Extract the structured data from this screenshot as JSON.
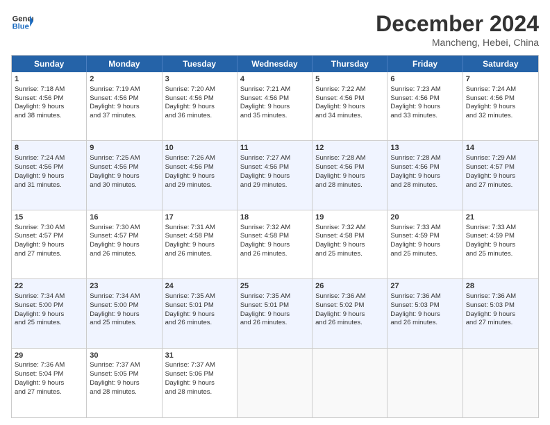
{
  "header": {
    "logo_line1": "General",
    "logo_line2": "Blue",
    "month": "December 2024",
    "location": "Mancheng, Hebei, China"
  },
  "days_of_week": [
    "Sunday",
    "Monday",
    "Tuesday",
    "Wednesday",
    "Thursday",
    "Friday",
    "Saturday"
  ],
  "rows": [
    {
      "alt": false,
      "cells": [
        {
          "day": "1",
          "lines": [
            "Sunrise: 7:18 AM",
            "Sunset: 4:56 PM",
            "Daylight: 9 hours",
            "and 38 minutes."
          ]
        },
        {
          "day": "2",
          "lines": [
            "Sunrise: 7:19 AM",
            "Sunset: 4:56 PM",
            "Daylight: 9 hours",
            "and 37 minutes."
          ]
        },
        {
          "day": "3",
          "lines": [
            "Sunrise: 7:20 AM",
            "Sunset: 4:56 PM",
            "Daylight: 9 hours",
            "and 36 minutes."
          ]
        },
        {
          "day": "4",
          "lines": [
            "Sunrise: 7:21 AM",
            "Sunset: 4:56 PM",
            "Daylight: 9 hours",
            "and 35 minutes."
          ]
        },
        {
          "day": "5",
          "lines": [
            "Sunrise: 7:22 AM",
            "Sunset: 4:56 PM",
            "Daylight: 9 hours",
            "and 34 minutes."
          ]
        },
        {
          "day": "6",
          "lines": [
            "Sunrise: 7:23 AM",
            "Sunset: 4:56 PM",
            "Daylight: 9 hours",
            "and 33 minutes."
          ]
        },
        {
          "day": "7",
          "lines": [
            "Sunrise: 7:24 AM",
            "Sunset: 4:56 PM",
            "Daylight: 9 hours",
            "and 32 minutes."
          ]
        }
      ]
    },
    {
      "alt": true,
      "cells": [
        {
          "day": "8",
          "lines": [
            "Sunrise: 7:24 AM",
            "Sunset: 4:56 PM",
            "Daylight: 9 hours",
            "and 31 minutes."
          ]
        },
        {
          "day": "9",
          "lines": [
            "Sunrise: 7:25 AM",
            "Sunset: 4:56 PM",
            "Daylight: 9 hours",
            "and 30 minutes."
          ]
        },
        {
          "day": "10",
          "lines": [
            "Sunrise: 7:26 AM",
            "Sunset: 4:56 PM",
            "Daylight: 9 hours",
            "and 29 minutes."
          ]
        },
        {
          "day": "11",
          "lines": [
            "Sunrise: 7:27 AM",
            "Sunset: 4:56 PM",
            "Daylight: 9 hours",
            "and 29 minutes."
          ]
        },
        {
          "day": "12",
          "lines": [
            "Sunrise: 7:28 AM",
            "Sunset: 4:56 PM",
            "Daylight: 9 hours",
            "and 28 minutes."
          ]
        },
        {
          "day": "13",
          "lines": [
            "Sunrise: 7:28 AM",
            "Sunset: 4:56 PM",
            "Daylight: 9 hours",
            "and 28 minutes."
          ]
        },
        {
          "day": "14",
          "lines": [
            "Sunrise: 7:29 AM",
            "Sunset: 4:57 PM",
            "Daylight: 9 hours",
            "and 27 minutes."
          ]
        }
      ]
    },
    {
      "alt": false,
      "cells": [
        {
          "day": "15",
          "lines": [
            "Sunrise: 7:30 AM",
            "Sunset: 4:57 PM",
            "Daylight: 9 hours",
            "and 27 minutes."
          ]
        },
        {
          "day": "16",
          "lines": [
            "Sunrise: 7:30 AM",
            "Sunset: 4:57 PM",
            "Daylight: 9 hours",
            "and 26 minutes."
          ]
        },
        {
          "day": "17",
          "lines": [
            "Sunrise: 7:31 AM",
            "Sunset: 4:58 PM",
            "Daylight: 9 hours",
            "and 26 minutes."
          ]
        },
        {
          "day": "18",
          "lines": [
            "Sunrise: 7:32 AM",
            "Sunset: 4:58 PM",
            "Daylight: 9 hours",
            "and 26 minutes."
          ]
        },
        {
          "day": "19",
          "lines": [
            "Sunrise: 7:32 AM",
            "Sunset: 4:58 PM",
            "Daylight: 9 hours",
            "and 25 minutes."
          ]
        },
        {
          "day": "20",
          "lines": [
            "Sunrise: 7:33 AM",
            "Sunset: 4:59 PM",
            "Daylight: 9 hours",
            "and 25 minutes."
          ]
        },
        {
          "day": "21",
          "lines": [
            "Sunrise: 7:33 AM",
            "Sunset: 4:59 PM",
            "Daylight: 9 hours",
            "and 25 minutes."
          ]
        }
      ]
    },
    {
      "alt": true,
      "cells": [
        {
          "day": "22",
          "lines": [
            "Sunrise: 7:34 AM",
            "Sunset: 5:00 PM",
            "Daylight: 9 hours",
            "and 25 minutes."
          ]
        },
        {
          "day": "23",
          "lines": [
            "Sunrise: 7:34 AM",
            "Sunset: 5:00 PM",
            "Daylight: 9 hours",
            "and 25 minutes."
          ]
        },
        {
          "day": "24",
          "lines": [
            "Sunrise: 7:35 AM",
            "Sunset: 5:01 PM",
            "Daylight: 9 hours",
            "and 26 minutes."
          ]
        },
        {
          "day": "25",
          "lines": [
            "Sunrise: 7:35 AM",
            "Sunset: 5:01 PM",
            "Daylight: 9 hours",
            "and 26 minutes."
          ]
        },
        {
          "day": "26",
          "lines": [
            "Sunrise: 7:36 AM",
            "Sunset: 5:02 PM",
            "Daylight: 9 hours",
            "and 26 minutes."
          ]
        },
        {
          "day": "27",
          "lines": [
            "Sunrise: 7:36 AM",
            "Sunset: 5:03 PM",
            "Daylight: 9 hours",
            "and 26 minutes."
          ]
        },
        {
          "day": "28",
          "lines": [
            "Sunrise: 7:36 AM",
            "Sunset: 5:03 PM",
            "Daylight: 9 hours",
            "and 27 minutes."
          ]
        }
      ]
    },
    {
      "alt": false,
      "cells": [
        {
          "day": "29",
          "lines": [
            "Sunrise: 7:36 AM",
            "Sunset: 5:04 PM",
            "Daylight: 9 hours",
            "and 27 minutes."
          ]
        },
        {
          "day": "30",
          "lines": [
            "Sunrise: 7:37 AM",
            "Sunset: 5:05 PM",
            "Daylight: 9 hours",
            "and 28 minutes."
          ]
        },
        {
          "day": "31",
          "lines": [
            "Sunrise: 7:37 AM",
            "Sunset: 5:06 PM",
            "Daylight: 9 hours",
            "and 28 minutes."
          ]
        },
        {
          "day": "",
          "lines": []
        },
        {
          "day": "",
          "lines": []
        },
        {
          "day": "",
          "lines": []
        },
        {
          "day": "",
          "lines": []
        }
      ]
    }
  ]
}
